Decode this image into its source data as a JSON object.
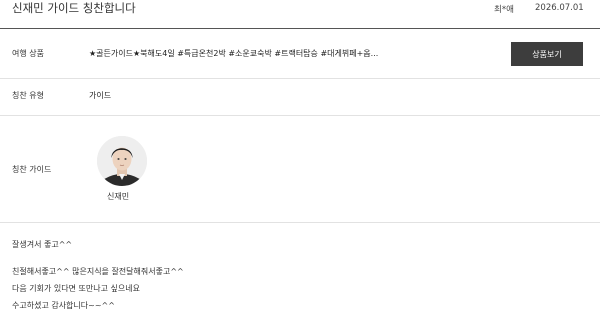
{
  "header": {
    "title": "신재민 가이드 칭찬합니다",
    "author": "최*애",
    "date": "2026.07.01"
  },
  "product": {
    "label": "여행 상품",
    "value": "★골든가이드★북해도4일 #특급온천2박 #소운쿄숙박 #트랙터탑승 #대게뷔페+옵...",
    "button": "상품보기"
  },
  "praise_type": {
    "label": "칭찬 유형",
    "value": "가이드"
  },
  "praise_guide": {
    "label": "칭찬 가이드",
    "name": "신재민",
    "avatar_icon": "person-photo-icon"
  },
  "content": {
    "lines": [
      "잘생겨서 좋고^^",
      "친절해서좋고^^ 많은지식을 잘전달해줘서좋고^^",
      "다음 기회가 있다면 또만나고 싶으네요",
      "수고하셨고 감사합니다~~^^"
    ]
  }
}
